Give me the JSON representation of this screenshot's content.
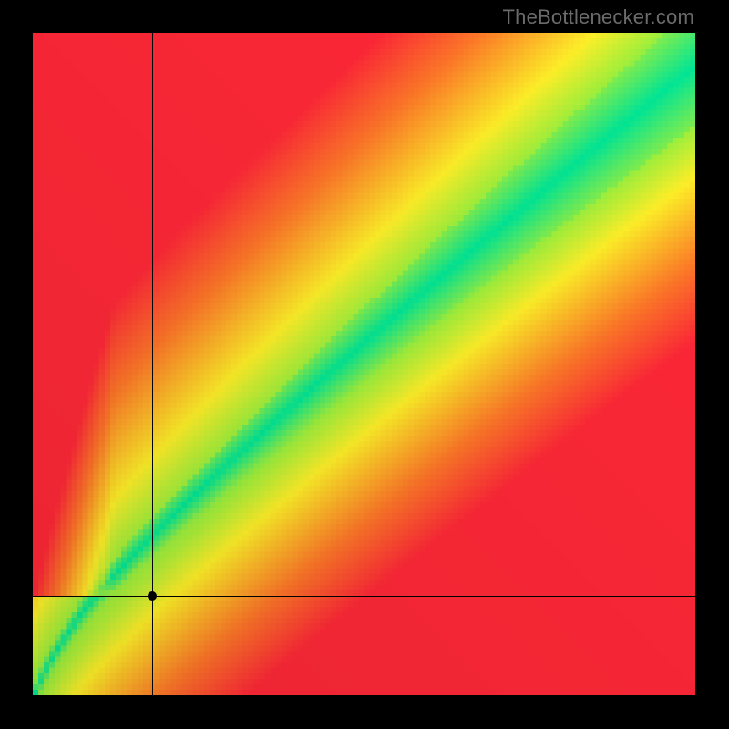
{
  "watermark": "TheBottlenecker.com",
  "chart_data": {
    "type": "heatmap",
    "title": "",
    "xlabel": "",
    "ylabel": "",
    "xlim": [
      0,
      100
    ],
    "ylim": [
      0,
      100
    ],
    "resolution": 120,
    "colorscale": "red→yellow→green→yellow (bottleneck)",
    "crosshair": {
      "x": 18.0,
      "y": 15.0
    },
    "curve": {
      "description": "Optimal (green) band; green where pairing is balanced",
      "center_function": "y = 7 * x^0.6 * (1 - 0.7*exp(-0.02*x)) / 7 scaled",
      "band_half_width_start": 1.5,
      "band_half_width_end": 9
    },
    "data_note": "Heatmap encodes bottleneck severity: 0 (green) along optimal curve, increasing to 1 (red) away from it. No explicit per-cell data labels visible."
  }
}
